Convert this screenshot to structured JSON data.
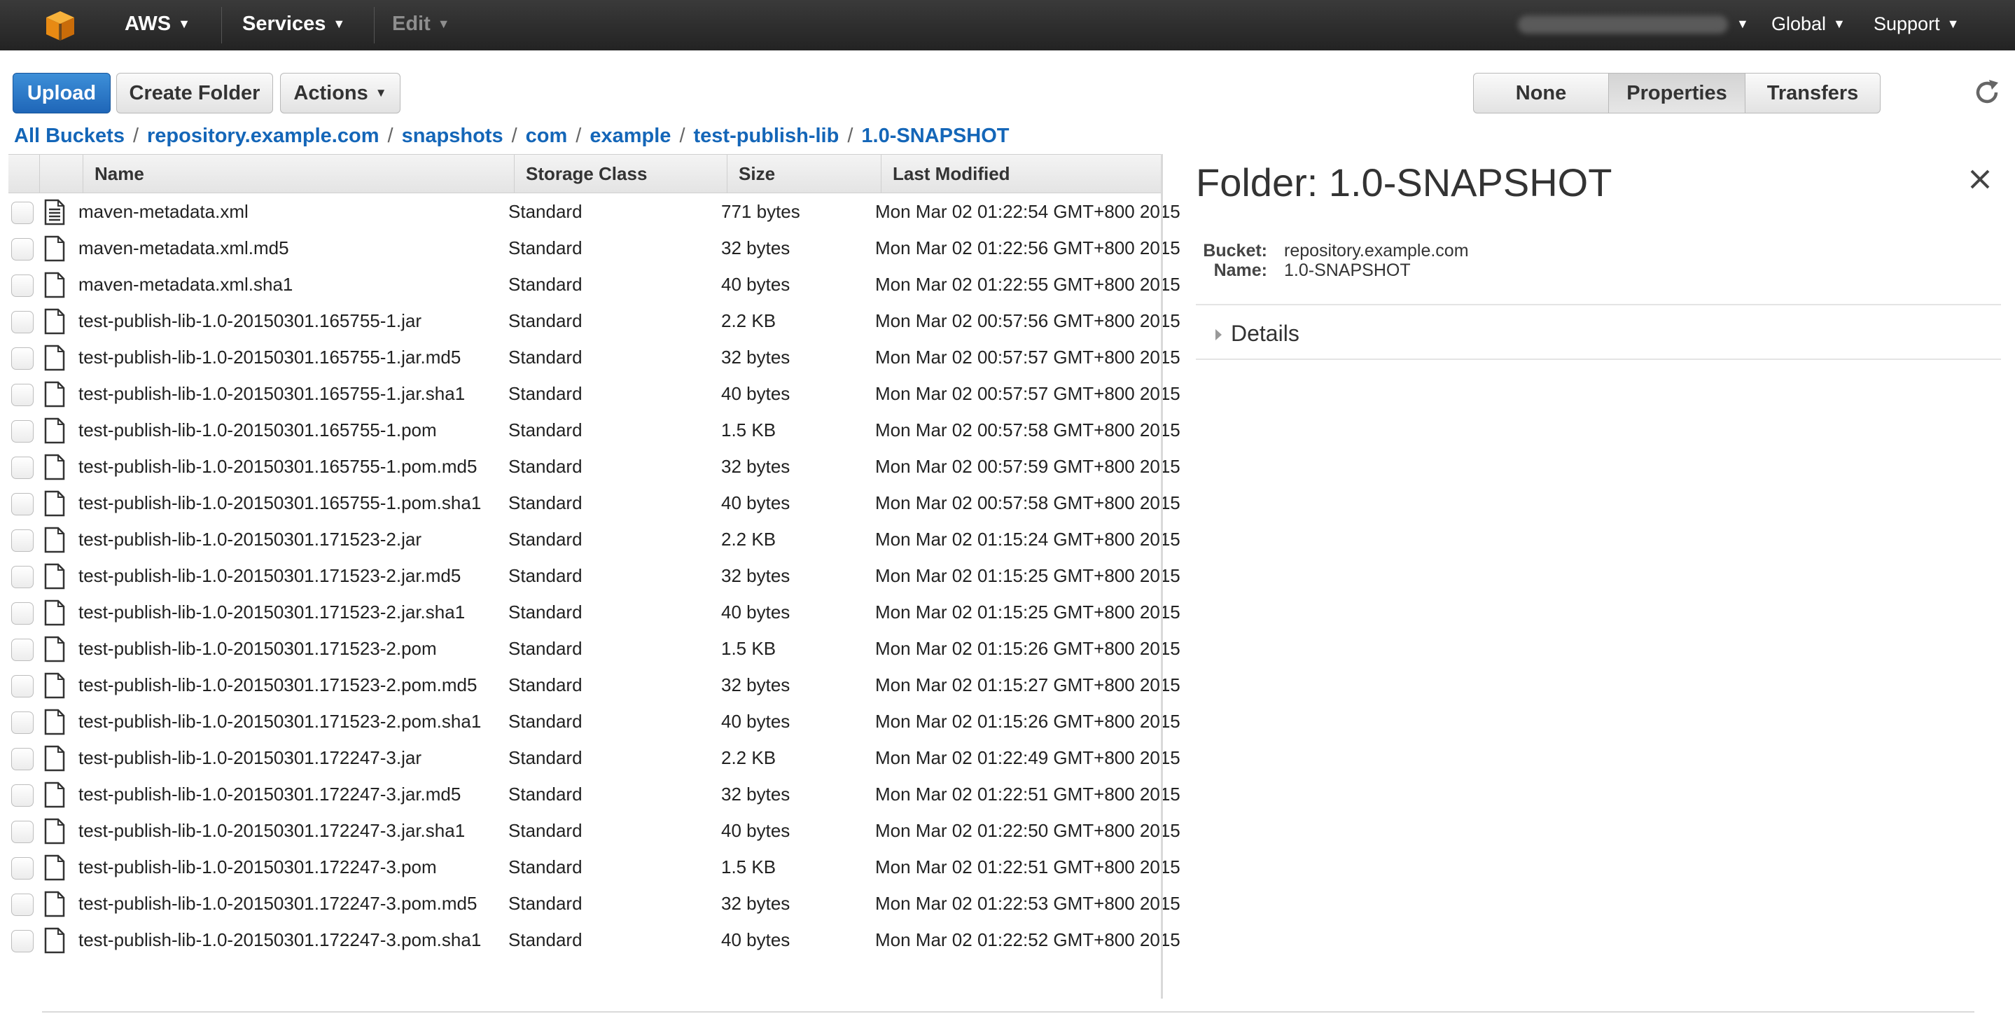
{
  "nav": {
    "brand": "AWS",
    "services": "Services",
    "edit": "Edit",
    "region": "Global",
    "support": "Support"
  },
  "toolbar": {
    "upload": "Upload",
    "create_folder": "Create Folder",
    "actions": "Actions",
    "views": [
      "None",
      "Properties",
      "Transfers"
    ],
    "active_view": "Properties"
  },
  "breadcrumb": [
    "All Buckets",
    "repository.example.com",
    "snapshots",
    "com",
    "example",
    "test-publish-lib",
    "1.0-SNAPSHOT"
  ],
  "table": {
    "columns": [
      "Name",
      "Storage Class",
      "Size",
      "Last Modified"
    ],
    "rows": [
      {
        "name": "maven-metadata.xml",
        "storage": "Standard",
        "size": "771 bytes",
        "modified": "Mon Mar 02 01:22:54 GMT+800 2015",
        "icon": "text-file-icon"
      },
      {
        "name": "maven-metadata.xml.md5",
        "storage": "Standard",
        "size": "32 bytes",
        "modified": "Mon Mar 02 01:22:56 GMT+800 2015",
        "icon": "file-icon"
      },
      {
        "name": "maven-metadata.xml.sha1",
        "storage": "Standard",
        "size": "40 bytes",
        "modified": "Mon Mar 02 01:22:55 GMT+800 2015",
        "icon": "file-icon"
      },
      {
        "name": "test-publish-lib-1.0-20150301.165755-1.jar",
        "storage": "Standard",
        "size": "2.2 KB",
        "modified": "Mon Mar 02 00:57:56 GMT+800 2015",
        "icon": "file-icon"
      },
      {
        "name": "test-publish-lib-1.0-20150301.165755-1.jar.md5",
        "storage": "Standard",
        "size": "32 bytes",
        "modified": "Mon Mar 02 00:57:57 GMT+800 2015",
        "icon": "file-icon"
      },
      {
        "name": "test-publish-lib-1.0-20150301.165755-1.jar.sha1",
        "storage": "Standard",
        "size": "40 bytes",
        "modified": "Mon Mar 02 00:57:57 GMT+800 2015",
        "icon": "file-icon"
      },
      {
        "name": "test-publish-lib-1.0-20150301.165755-1.pom",
        "storage": "Standard",
        "size": "1.5 KB",
        "modified": "Mon Mar 02 00:57:58 GMT+800 2015",
        "icon": "file-icon"
      },
      {
        "name": "test-publish-lib-1.0-20150301.165755-1.pom.md5",
        "storage": "Standard",
        "size": "32 bytes",
        "modified": "Mon Mar 02 00:57:59 GMT+800 2015",
        "icon": "file-icon"
      },
      {
        "name": "test-publish-lib-1.0-20150301.165755-1.pom.sha1",
        "storage": "Standard",
        "size": "40 bytes",
        "modified": "Mon Mar 02 00:57:58 GMT+800 2015",
        "icon": "file-icon"
      },
      {
        "name": "test-publish-lib-1.0-20150301.171523-2.jar",
        "storage": "Standard",
        "size": "2.2 KB",
        "modified": "Mon Mar 02 01:15:24 GMT+800 2015",
        "icon": "file-icon"
      },
      {
        "name": "test-publish-lib-1.0-20150301.171523-2.jar.md5",
        "storage": "Standard",
        "size": "32 bytes",
        "modified": "Mon Mar 02 01:15:25 GMT+800 2015",
        "icon": "file-icon"
      },
      {
        "name": "test-publish-lib-1.0-20150301.171523-2.jar.sha1",
        "storage": "Standard",
        "size": "40 bytes",
        "modified": "Mon Mar 02 01:15:25 GMT+800 2015",
        "icon": "file-icon"
      },
      {
        "name": "test-publish-lib-1.0-20150301.171523-2.pom",
        "storage": "Standard",
        "size": "1.5 KB",
        "modified": "Mon Mar 02 01:15:26 GMT+800 2015",
        "icon": "file-icon"
      },
      {
        "name": "test-publish-lib-1.0-20150301.171523-2.pom.md5",
        "storage": "Standard",
        "size": "32 bytes",
        "modified": "Mon Mar 02 01:15:27 GMT+800 2015",
        "icon": "file-icon"
      },
      {
        "name": "test-publish-lib-1.0-20150301.171523-2.pom.sha1",
        "storage": "Standard",
        "size": "40 bytes",
        "modified": "Mon Mar 02 01:15:26 GMT+800 2015",
        "icon": "file-icon"
      },
      {
        "name": "test-publish-lib-1.0-20150301.172247-3.jar",
        "storage": "Standard",
        "size": "2.2 KB",
        "modified": "Mon Mar 02 01:22:49 GMT+800 2015",
        "icon": "file-icon"
      },
      {
        "name": "test-publish-lib-1.0-20150301.172247-3.jar.md5",
        "storage": "Standard",
        "size": "32 bytes",
        "modified": "Mon Mar 02 01:22:51 GMT+800 2015",
        "icon": "file-icon"
      },
      {
        "name": "test-publish-lib-1.0-20150301.172247-3.jar.sha1",
        "storage": "Standard",
        "size": "40 bytes",
        "modified": "Mon Mar 02 01:22:50 GMT+800 2015",
        "icon": "file-icon"
      },
      {
        "name": "test-publish-lib-1.0-20150301.172247-3.pom",
        "storage": "Standard",
        "size": "1.5 KB",
        "modified": "Mon Mar 02 01:22:51 GMT+800 2015",
        "icon": "file-icon"
      },
      {
        "name": "test-publish-lib-1.0-20150301.172247-3.pom.md5",
        "storage": "Standard",
        "size": "32 bytes",
        "modified": "Mon Mar 02 01:22:53 GMT+800 2015",
        "icon": "file-icon"
      },
      {
        "name": "test-publish-lib-1.0-20150301.172247-3.pom.sha1",
        "storage": "Standard",
        "size": "40 bytes",
        "modified": "Mon Mar 02 01:22:52 GMT+800 2015",
        "icon": "file-icon"
      }
    ]
  },
  "panel": {
    "title": "Folder: 1.0-SNAPSHOT",
    "bucket_label": "Bucket:",
    "bucket_value": "repository.example.com",
    "name_label": "Name:",
    "name_value": "1.0-SNAPSHOT",
    "details": "Details"
  },
  "colors": {
    "link": "#1466b8",
    "primary_button": "#2a77c9",
    "nav_bg": "#2b2b2b",
    "aws_logo": "#f7a31c"
  }
}
